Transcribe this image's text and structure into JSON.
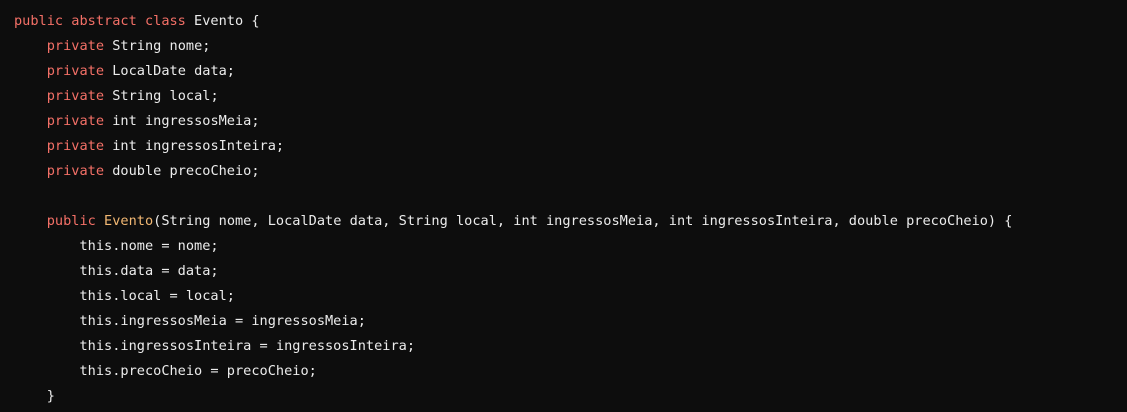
{
  "code": {
    "language": "java",
    "lines": [
      [
        {
          "t": "public abstract class",
          "c": "kw"
        },
        {
          "t": " Evento {",
          "c": "tx"
        }
      ],
      [
        {
          "t": "    ",
          "c": "tx"
        },
        {
          "t": "private",
          "c": "kw"
        },
        {
          "t": " String nome;",
          "c": "tx"
        }
      ],
      [
        {
          "t": "    ",
          "c": "tx"
        },
        {
          "t": "private",
          "c": "kw"
        },
        {
          "t": " LocalDate data;",
          "c": "tx"
        }
      ],
      [
        {
          "t": "    ",
          "c": "tx"
        },
        {
          "t": "private",
          "c": "kw"
        },
        {
          "t": " String local;",
          "c": "tx"
        }
      ],
      [
        {
          "t": "    ",
          "c": "tx"
        },
        {
          "t": "private",
          "c": "kw"
        },
        {
          "t": " int ingressosMeia;",
          "c": "tx"
        }
      ],
      [
        {
          "t": "    ",
          "c": "tx"
        },
        {
          "t": "private",
          "c": "kw"
        },
        {
          "t": " int ingressosInteira;",
          "c": "tx"
        }
      ],
      [
        {
          "t": "    ",
          "c": "tx"
        },
        {
          "t": "private",
          "c": "kw"
        },
        {
          "t": " double precoCheio;",
          "c": "tx"
        }
      ],
      [],
      [
        {
          "t": "    ",
          "c": "tx"
        },
        {
          "t": "public",
          "c": "kw"
        },
        {
          "t": " ",
          "c": "tx"
        },
        {
          "t": "Evento",
          "c": "fn"
        },
        {
          "t": "(String nome, LocalDate data, String local, int ingressosMeia, int ingressosInteira, double precoCheio) {",
          "c": "tx"
        }
      ],
      [
        {
          "t": "        this.nome = nome;",
          "c": "tx"
        }
      ],
      [
        {
          "t": "        this.data = data;",
          "c": "tx"
        }
      ],
      [
        {
          "t": "        this.local = local;",
          "c": "tx"
        }
      ],
      [
        {
          "t": "        this.ingressosMeia = ingressosMeia;",
          "c": "tx"
        }
      ],
      [
        {
          "t": "        this.ingressosInteira = ingressosInteira;",
          "c": "tx"
        }
      ],
      [
        {
          "t": "        this.precoCheio = precoCheio;",
          "c": "tx"
        }
      ],
      [
        {
          "t": "    }",
          "c": "tx"
        }
      ]
    ]
  },
  "colors": {
    "background": "#0d0d0d",
    "keyword": "#f47067",
    "function_name": "#f2b873",
    "text": "#ececec"
  }
}
